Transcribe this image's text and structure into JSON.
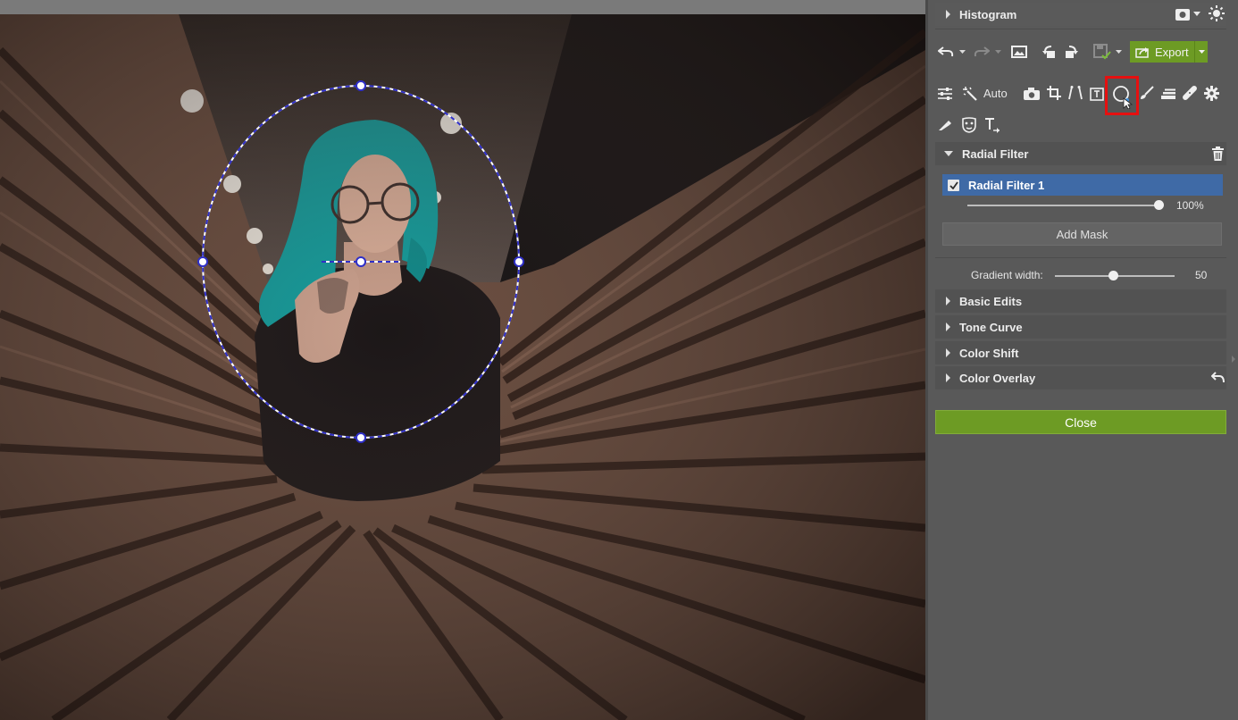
{
  "panel": {
    "histogram": {
      "title": "Histogram",
      "icons": [
        "camera-mode-icon",
        "chevron-down-icon",
        "settings-sun-icon"
      ]
    },
    "toolbar": {
      "export_label": "Export",
      "auto_label": "Auto",
      "selected_tool": "radial-filter-icon",
      "selected_tool_highlight": "#e61010"
    },
    "radial_filter": {
      "title": "Radial Filter",
      "filters": [
        {
          "name": "Radial Filter 1",
          "checked": true,
          "opacity": "100%"
        }
      ],
      "add_mask_label": "Add Mask",
      "gradient_width_label": "Gradient width:",
      "gradient_width_value": "50"
    },
    "sections": [
      {
        "title": "Basic Edits"
      },
      {
        "title": "Tone Curve"
      },
      {
        "title": "Color Shift"
      },
      {
        "title": "Color Overlay"
      }
    ],
    "close_label": "Close"
  },
  "colors": {
    "accent_green": "#6d9b24",
    "selection_blue": "#3f6aa6",
    "radial_handle": "#2f2fc8"
  }
}
